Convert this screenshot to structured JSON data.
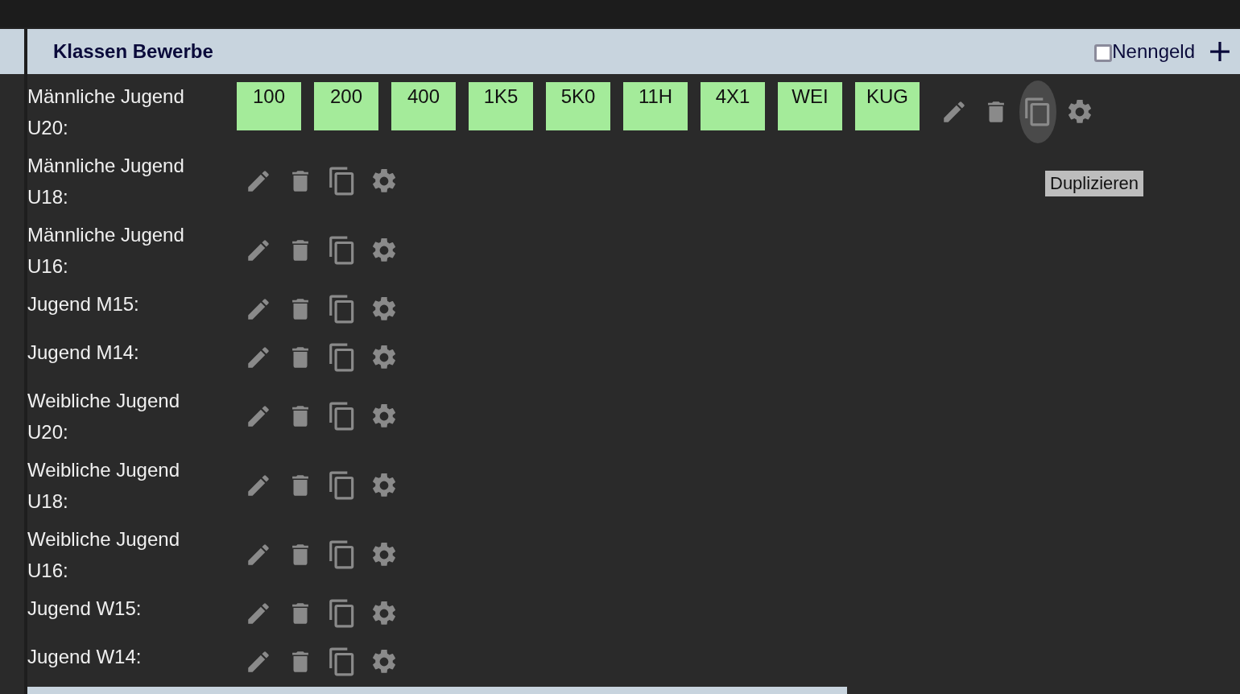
{
  "header": {
    "title": "Klassen Bewerbe",
    "fee_checkbox": {
      "label": "Nenngeld",
      "checked": false
    }
  },
  "rows": [
    {
      "label": "Männliche Jugend U20:",
      "events": [
        "100",
        "200",
        "400",
        "1K5",
        "5K0",
        "11H",
        "4X1",
        "WEI",
        "KUG"
      ],
      "copy_hovered": true,
      "tooltip": "Duplizieren"
    },
    {
      "label": "Männliche Jugend U18:",
      "events": [],
      "copy_hovered": false
    },
    {
      "label": "Männliche Jugend U16:",
      "events": [],
      "copy_hovered": false
    },
    {
      "label": "Jugend M15:",
      "events": [],
      "copy_hovered": false
    },
    {
      "label": "Jugend M14:",
      "events": [],
      "copy_hovered": false
    },
    {
      "label": "Weibliche Jugend U20:",
      "events": [],
      "copy_hovered": false
    },
    {
      "label": "Weibliche Jugend U18:",
      "events": [],
      "copy_hovered": false
    },
    {
      "label": "Weibliche Jugend U16:",
      "events": [],
      "copy_hovered": false
    },
    {
      "label": "Jugend W15:",
      "events": [],
      "copy_hovered": false
    },
    {
      "label": "Jugend W14:",
      "events": [],
      "copy_hovered": false
    }
  ]
}
